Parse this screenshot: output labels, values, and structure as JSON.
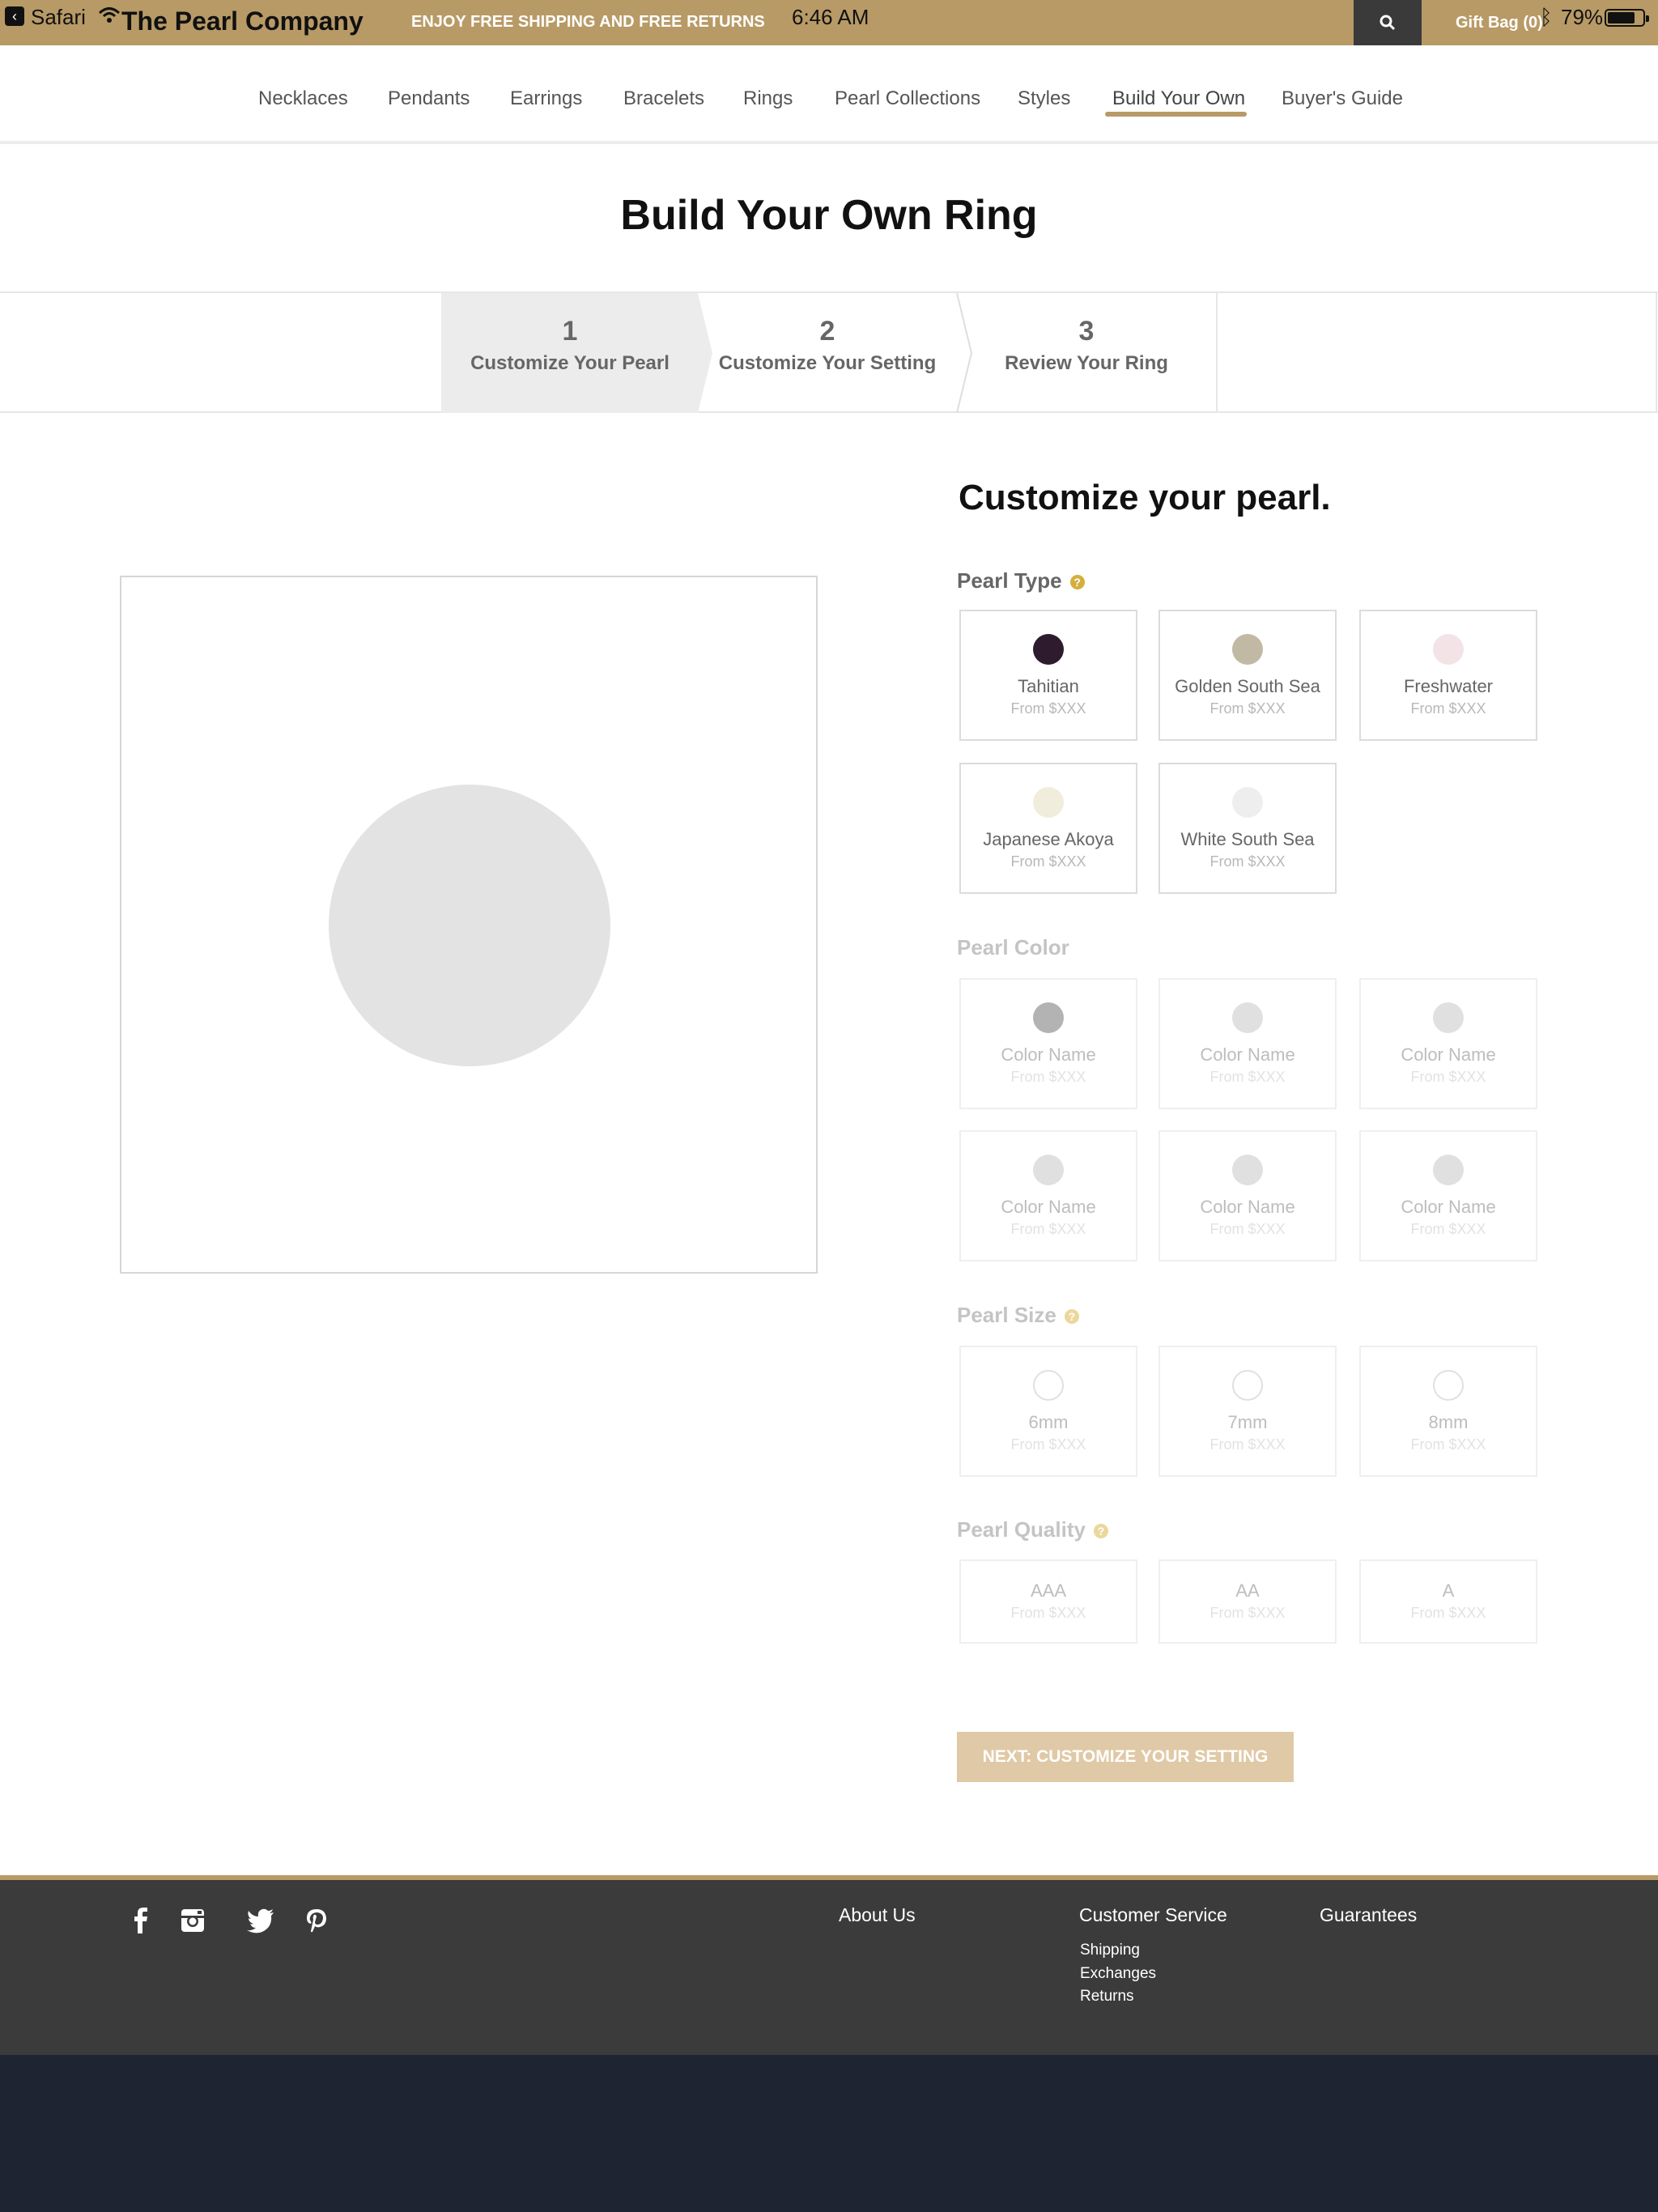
{
  "status_bar": {
    "back_app": "Safari",
    "time": "6:46 AM",
    "battery": "79%",
    "battery_level": 0.79
  },
  "header": {
    "brand": "The Pearl Company",
    "promo": "ENJOY FREE SHIPPING AND FREE RETURNS",
    "gift_bag": "Gift Bag (0)",
    "search_icon": "search-icon",
    "accent_color": "#b89a66"
  },
  "nav": {
    "items": [
      "Necklaces",
      "Pendants",
      "Earrings",
      "Bracelets",
      "Rings",
      "Pearl Collections",
      "Styles",
      "Build Your Own",
      "Buyer's Guide"
    ],
    "active": "Build Your Own"
  },
  "page_title": "Build Your Own Ring",
  "steps": [
    {
      "num": "1",
      "label": "Customize Your Pearl",
      "active": true
    },
    {
      "num": "2",
      "label": "Customize Your Setting",
      "active": false
    },
    {
      "num": "3",
      "label": "Review Your Ring",
      "active": false
    }
  ],
  "customize": {
    "title": "Customize your pearl.",
    "pearl_type": {
      "title": "Pearl Type",
      "options": [
        {
          "name": "Tahitian",
          "price": "From $XXX",
          "color": "#2e1c2e"
        },
        {
          "name": "Golden South Sea",
          "price": "From $XXX",
          "color": "#c1b9a3"
        },
        {
          "name": "Freshwater",
          "price": "From $XXX",
          "color": "#f3e3e6"
        },
        {
          "name": "Japanese Akoya",
          "price": "From $XXX",
          "color": "#f1eddc"
        },
        {
          "name": "White South Sea",
          "price": "From $XXX",
          "color": "#eeeeee"
        }
      ]
    },
    "pearl_color": {
      "title": "Pearl Color",
      "options": [
        {
          "name": "Color Name",
          "price": "From $XXX",
          "color": "#b3b3b3"
        },
        {
          "name": "Color Name",
          "price": "From $XXX",
          "color": "#e0e0e0"
        },
        {
          "name": "Color Name",
          "price": "From $XXX",
          "color": "#e0e0e0"
        },
        {
          "name": "Color Name",
          "price": "From $XXX",
          "color": "#e0e0e0"
        },
        {
          "name": "Color Name",
          "price": "From $XXX",
          "color": "#e0e0e0"
        },
        {
          "name": "Color Name",
          "price": "From $XXX",
          "color": "#e0e0e0"
        }
      ]
    },
    "pearl_size": {
      "title": "Pearl Size",
      "options": [
        {
          "name": "6mm",
          "price": "From $XXX"
        },
        {
          "name": "7mm",
          "price": "From $XXX"
        },
        {
          "name": "8mm",
          "price": "From $XXX"
        }
      ]
    },
    "pearl_quality": {
      "title": "Pearl Quality",
      "options": [
        {
          "name": "AAA",
          "price": "From $XXX"
        },
        {
          "name": "AA",
          "price": "From $XXX"
        },
        {
          "name": "A",
          "price": "From $XXX"
        }
      ]
    },
    "next_button": "NEXT: CUSTOMIZE YOUR SETTING"
  },
  "footer": {
    "social": [
      "facebook-icon",
      "instagram-icon",
      "twitter-icon",
      "pinterest-icon"
    ],
    "about": "About Us",
    "customer_service": {
      "title": "Customer Service",
      "links": [
        "Shipping",
        "Exchanges",
        "Returns"
      ]
    },
    "guarantees": "Guarantees"
  }
}
